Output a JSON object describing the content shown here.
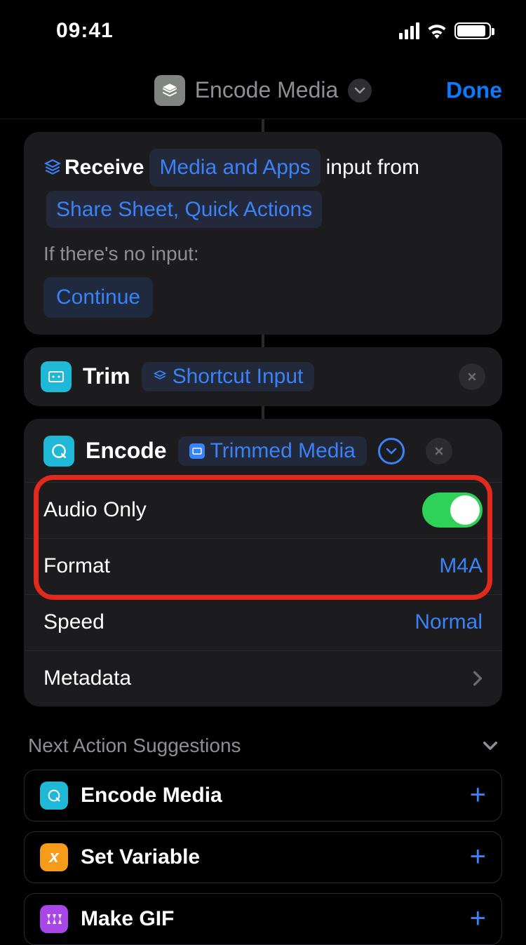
{
  "status": {
    "time": "09:41"
  },
  "header": {
    "title": "Encode Media",
    "done": "Done"
  },
  "receive": {
    "verb": "Receive",
    "types": "Media and Apps",
    "suffix": "input from",
    "sources": "Share Sheet, Quick Actions",
    "no_input_label": "If there's no input:",
    "no_input_action": "Continue"
  },
  "trim": {
    "title": "Trim",
    "variable": "Shortcut Input"
  },
  "encode": {
    "title": "Encode",
    "variable": "Trimmed Media",
    "options": {
      "audio_only": {
        "label": "Audio Only",
        "on": true
      },
      "format": {
        "label": "Format",
        "value": "M4A"
      },
      "speed": {
        "label": "Speed",
        "value": "Normal"
      },
      "metadata": {
        "label": "Metadata"
      }
    }
  },
  "suggestions": {
    "header": "Next Action Suggestions",
    "items": [
      {
        "label": "Encode Media",
        "icon": "quicktime"
      },
      {
        "label": "Set Variable",
        "icon": "variable"
      },
      {
        "label": "Make GIF",
        "icon": "gif"
      }
    ]
  }
}
